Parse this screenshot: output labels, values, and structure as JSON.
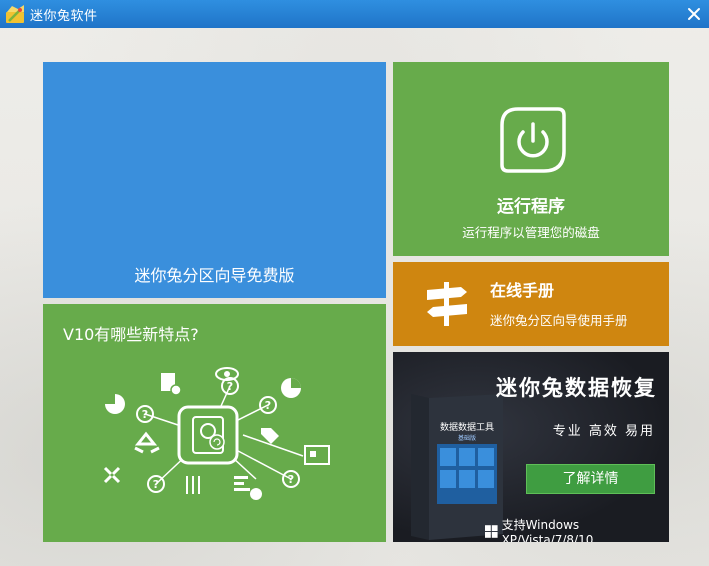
{
  "window": {
    "title": "迷你兔软件"
  },
  "tiles": {
    "free_edition": {
      "label": "迷你兔分区向导免费版"
    },
    "new_features": {
      "title": "V10有哪些新特点?"
    },
    "run_program": {
      "title": "运行程序",
      "subtitle": "运行程序以管理您的磁盘"
    },
    "manual": {
      "title": "在线手册",
      "subtitle": "迷你兔分区向导使用手册"
    },
    "ad": {
      "title": "迷你兔数据恢复",
      "subtitle": "专业 高效 易用",
      "button": "了解详情",
      "support": "支持Windows XP/Vista/7/8/10",
      "box_label": "数据数据工具",
      "box_edition": "基础版"
    }
  },
  "colors": {
    "title_bar": "#2f8fe0",
    "blue_tile": "#3a8fdc",
    "green_tile": "#67ab4b",
    "orange_tile": "#cf8610",
    "dark_tile": "#1d1f26",
    "ad_button": "#3f9d41"
  },
  "icons": [
    "app-icon",
    "close-icon",
    "power-icon",
    "signpost-icon",
    "disk-hub-icon",
    "windows-icon"
  ]
}
